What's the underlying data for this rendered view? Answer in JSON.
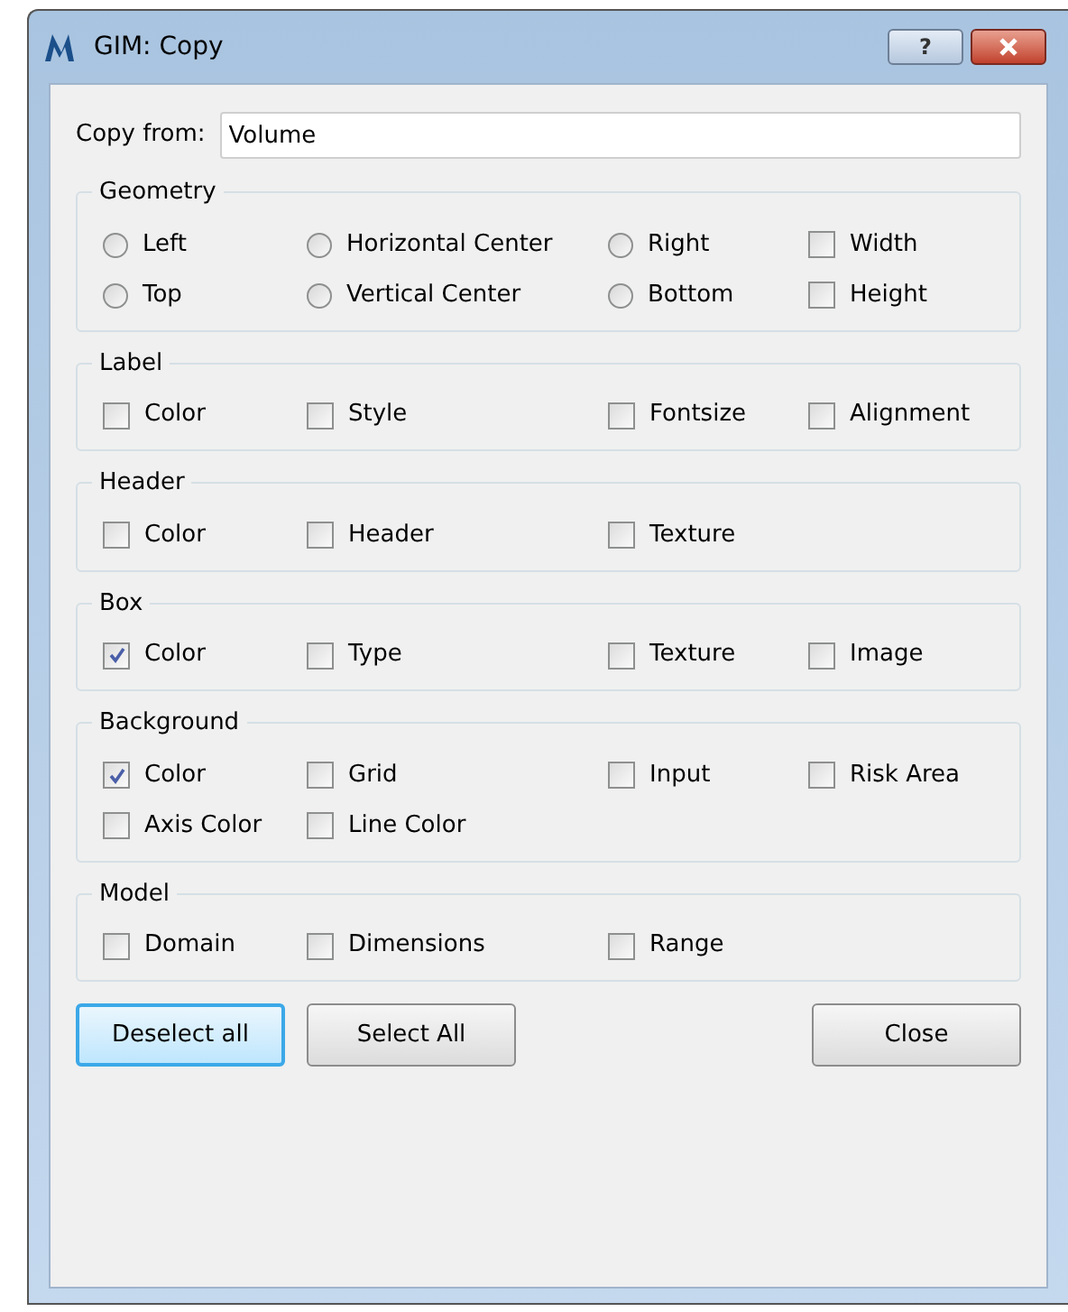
{
  "window": {
    "title": "GIM: Copy",
    "help_button": "?"
  },
  "copy_from": {
    "label": "Copy from:",
    "value": "Volume"
  },
  "groups": [
    {
      "title": "Geometry",
      "items": [
        {
          "label": "Left",
          "kind": "radio",
          "checked": false
        },
        {
          "label": "Horizontal Center",
          "kind": "radio",
          "checked": false
        },
        {
          "label": "Right",
          "kind": "radio",
          "checked": false
        },
        {
          "label": "Width",
          "kind": "checkbox",
          "checked": false
        },
        {
          "label": "Top",
          "kind": "radio",
          "checked": false
        },
        {
          "label": "Vertical Center",
          "kind": "radio",
          "checked": false
        },
        {
          "label": "Bottom",
          "kind": "radio",
          "checked": false
        },
        {
          "label": "Height",
          "kind": "checkbox",
          "checked": false
        }
      ]
    },
    {
      "title": "Label",
      "items": [
        {
          "label": "Color",
          "kind": "checkbox",
          "checked": false
        },
        {
          "label": "Style",
          "kind": "checkbox",
          "checked": false
        },
        {
          "label": "Fontsize",
          "kind": "checkbox",
          "checked": false
        },
        {
          "label": "Alignment",
          "kind": "checkbox",
          "checked": false
        }
      ]
    },
    {
      "title": "Header",
      "items": [
        {
          "label": "Color",
          "kind": "checkbox",
          "checked": false
        },
        {
          "label": "Header",
          "kind": "checkbox",
          "checked": false
        },
        {
          "label": "Texture",
          "kind": "checkbox",
          "checked": false
        }
      ]
    },
    {
      "title": "Box",
      "items": [
        {
          "label": "Color",
          "kind": "checkbox",
          "checked": true
        },
        {
          "label": "Type",
          "kind": "checkbox",
          "checked": false
        },
        {
          "label": "Texture",
          "kind": "checkbox",
          "checked": false
        },
        {
          "label": "Image",
          "kind": "checkbox",
          "checked": false
        }
      ]
    },
    {
      "title": "Background",
      "items": [
        {
          "label": "Color",
          "kind": "checkbox",
          "checked": true
        },
        {
          "label": "Grid",
          "kind": "checkbox",
          "checked": false
        },
        {
          "label": "Input",
          "kind": "checkbox",
          "checked": false
        },
        {
          "label": "Risk Area",
          "kind": "checkbox",
          "checked": false
        },
        {
          "label": "Axis Color",
          "kind": "checkbox",
          "checked": false
        },
        {
          "label": "Line Color",
          "kind": "checkbox",
          "checked": false
        }
      ]
    },
    {
      "title": "Model",
      "items": [
        {
          "label": "Domain",
          "kind": "checkbox",
          "checked": false
        },
        {
          "label": "Dimensions",
          "kind": "checkbox",
          "checked": false
        },
        {
          "label": "Range",
          "kind": "checkbox",
          "checked": false
        }
      ]
    }
  ],
  "buttons": [
    {
      "label": "Deselect all",
      "selected": true
    },
    {
      "label": "Select All",
      "selected": false
    },
    {
      "label": "Close",
      "selected": false
    }
  ]
}
